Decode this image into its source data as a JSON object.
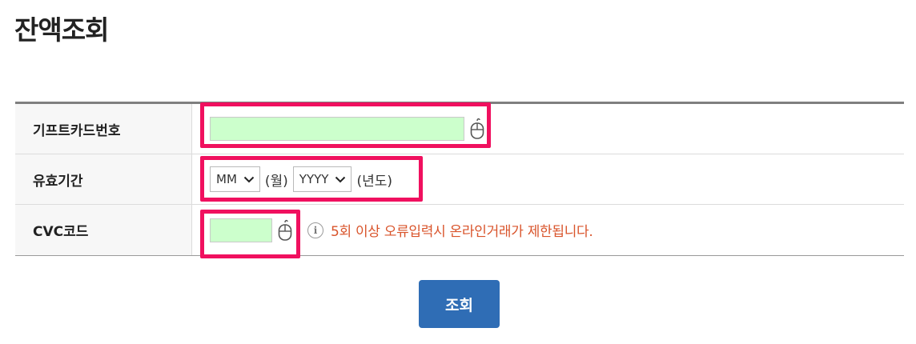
{
  "page": {
    "title": "잔액조회"
  },
  "form": {
    "card_number": {
      "label": "기프트카드번호",
      "value": ""
    },
    "expiry": {
      "label": "유효기간",
      "month_selected": "MM",
      "month_suffix": "(월)",
      "year_selected": "YYYY",
      "year_suffix": "(년도)"
    },
    "cvc": {
      "label": "CVC코드",
      "value": "",
      "notice": "5회 이상 오류입력시 온라인거래가 제한됩니다.",
      "notice_icon": "info-icon"
    }
  },
  "actions": {
    "submit_label": "조회"
  },
  "colors": {
    "highlight": "#f0105f",
    "input_bg": "#ccffcc",
    "button_bg": "#2f6db5",
    "notice": "#d9542b"
  },
  "icons": {
    "mouse": "mouse-icon",
    "chevron": "chevron-down-icon"
  }
}
